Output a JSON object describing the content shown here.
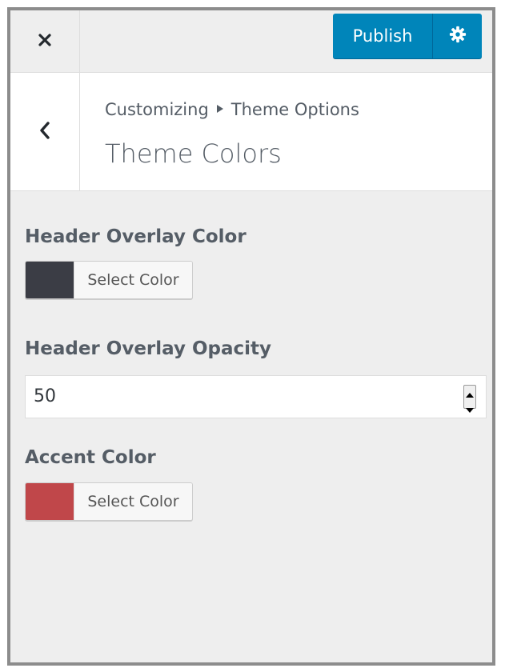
{
  "topbar": {
    "close_icon": "close-icon",
    "publish_label": "Publish",
    "settings_icon": "gear-icon",
    "accent": "#0085ba"
  },
  "section": {
    "back_icon": "chevron-left-icon",
    "breadcrumb_parent": "Customizing",
    "breadcrumb_separator_icon": "triangle-right-icon",
    "breadcrumb_current": "Theme Options",
    "title": "Theme Colors"
  },
  "controls": {
    "header_overlay_color": {
      "label": "Header Overlay Color",
      "button_label": "Select Color",
      "swatch_color": "#3b3d45"
    },
    "header_overlay_opacity": {
      "label": "Header Overlay Opacity",
      "value": "50"
    },
    "accent_color": {
      "label": "Accent Color",
      "button_label": "Select Color",
      "swatch_color": "#c0474a"
    }
  }
}
